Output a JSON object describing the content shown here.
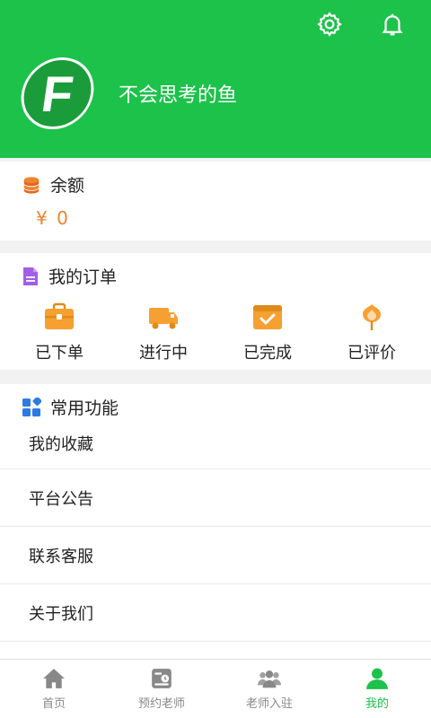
{
  "header": {
    "username": "不会思考的鱼",
    "avatar_letter": "F",
    "settings_icon": "gear-icon",
    "notify_icon": "bell-icon",
    "bg_color": "#1cc24a"
  },
  "balance": {
    "title": "余额",
    "icon": "coins-icon",
    "value": "¥ 0",
    "value_color": "#f0832c"
  },
  "orders": {
    "title": "我的订单",
    "icon": "document-icon",
    "items": [
      {
        "label": "已下单",
        "icon": "briefcase-icon"
      },
      {
        "label": "进行中",
        "icon": "truck-icon"
      },
      {
        "label": "已完成",
        "icon": "calendar-check-icon"
      },
      {
        "label": "已评价",
        "icon": "flower-icon"
      }
    ]
  },
  "functions": {
    "title": "常用功能",
    "icon": "grid-icon",
    "items": [
      {
        "label": "我的收藏"
      },
      {
        "label": "平台公告"
      },
      {
        "label": "联系客服"
      },
      {
        "label": "关于我们"
      }
    ]
  },
  "tabbar": {
    "items": [
      {
        "label": "首页",
        "icon": "home-icon",
        "active": false
      },
      {
        "label": "预约老师",
        "icon": "schedule-icon",
        "active": false
      },
      {
        "label": "老师入驻",
        "icon": "people-icon",
        "active": false
      },
      {
        "label": "我的",
        "icon": "person-icon",
        "active": true
      }
    ],
    "active_color": "#1cc24a",
    "inactive_color": "#888888"
  }
}
